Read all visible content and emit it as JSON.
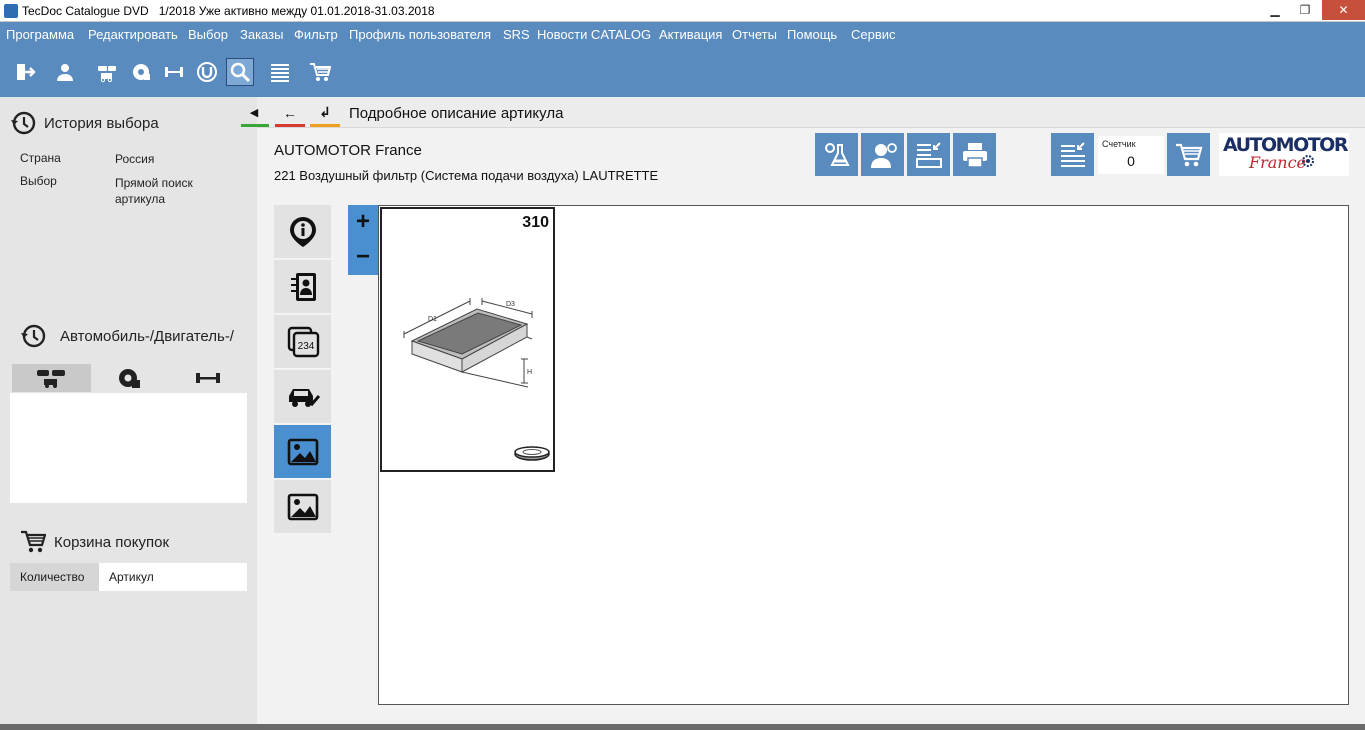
{
  "window": {
    "title": "TecDoc Catalogue DVD   1/2018 Уже активно между 01.01.2018-31.03.2018",
    "minimize": "▁",
    "maximize": "❐",
    "close": "✕"
  },
  "menu": [
    "Программа",
    "Редактировать",
    "Выбор",
    "Заказы",
    "Фильтр",
    "Профиль пользователя",
    "SRS",
    "Новости CATALOG",
    "Активация",
    "Отчеты",
    "Помощь",
    "Сервис"
  ],
  "toolbar_icons": [
    "exit-icon",
    "user-icon",
    "vehicles-icon",
    "engine-icon",
    "axle-icon",
    "universal-parts-icon",
    "search-icon",
    "list-icon",
    "cart-icon"
  ],
  "left": {
    "history_title": "История выбора",
    "country_label": "Страна",
    "country_value": "Россия",
    "selection_label": "Выбор",
    "selection_value_1": "Прямой поиск",
    "selection_value_2": "артикула",
    "vehicle_title": "Автомобиль-/Двигатель-/",
    "cart_title": "Корзина покупок",
    "cart_col_qty": "Количество",
    "cart_col_article": "Артикул"
  },
  "nav": {
    "collapse": "◀",
    "back": "🡐",
    "return": "↲",
    "page_title": "Подробное описание артикула",
    "colors": {
      "green": "#3aa63a",
      "red": "#d43a2f",
      "orange": "#f0a020"
    }
  },
  "article": {
    "brand": "AUTOMOTOR France",
    "description": "221 Воздушный фильтр (Система подачи воздуха) LAUTRETTE"
  },
  "counter": {
    "label": "Счетчик",
    "value": "0"
  },
  "logo": {
    "line1": "AUTOMOTOR",
    "line2": "France"
  },
  "zoom": {
    "plus": "+",
    "minus": "−"
  },
  "image": {
    "number": "310",
    "dim_d1": "D1",
    "dim_d3": "D3",
    "dim_h": "H"
  },
  "colors": {
    "accent": "#5a8bbf",
    "tab_active": "#4a90d0",
    "brand_blue": "#1b2e63",
    "brand_red": "#c0262d"
  }
}
